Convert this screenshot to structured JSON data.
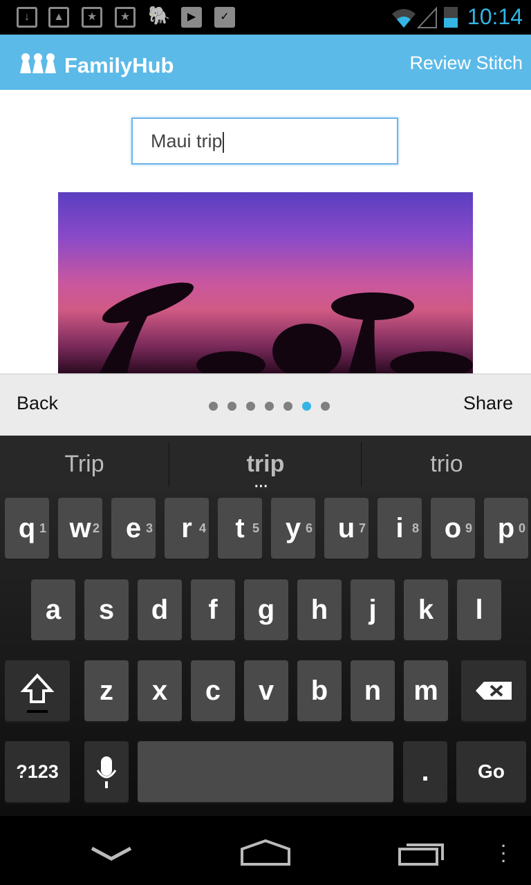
{
  "status_bar": {
    "time": "10:14",
    "icons": [
      "download-icon",
      "gallery-icon",
      "bookmark-star-icon",
      "bookmark-star-icon",
      "evernote-icon",
      "play-store-icon",
      "shopping-check-icon"
    ]
  },
  "app_bar": {
    "app_name": "FamilyHub",
    "action": "Review Stitch"
  },
  "title_input": {
    "value": "Maui trip"
  },
  "bottom_bar": {
    "back": "Back",
    "share": "Share",
    "page_count": 7,
    "current_page": 6
  },
  "suggestions": [
    "Trip",
    "trip",
    "trio"
  ],
  "keyboard": {
    "row1": [
      [
        "q",
        "1"
      ],
      [
        "w",
        "2"
      ],
      [
        "e",
        "3"
      ],
      [
        "r",
        "4"
      ],
      [
        "t",
        "5"
      ],
      [
        "y",
        "6"
      ],
      [
        "u",
        "7"
      ],
      [
        "i",
        "8"
      ],
      [
        "o",
        "9"
      ],
      [
        "p",
        "0"
      ]
    ],
    "row2": [
      "a",
      "s",
      "d",
      "f",
      "g",
      "h",
      "j",
      "k",
      "l"
    ],
    "row3": [
      "z",
      "x",
      "c",
      "v",
      "b",
      "n",
      "m"
    ],
    "symbols": "?123",
    "period": ".",
    "go": "Go"
  },
  "colors": {
    "accent": "#5bbae8",
    "active_dot": "#33b5e5"
  }
}
